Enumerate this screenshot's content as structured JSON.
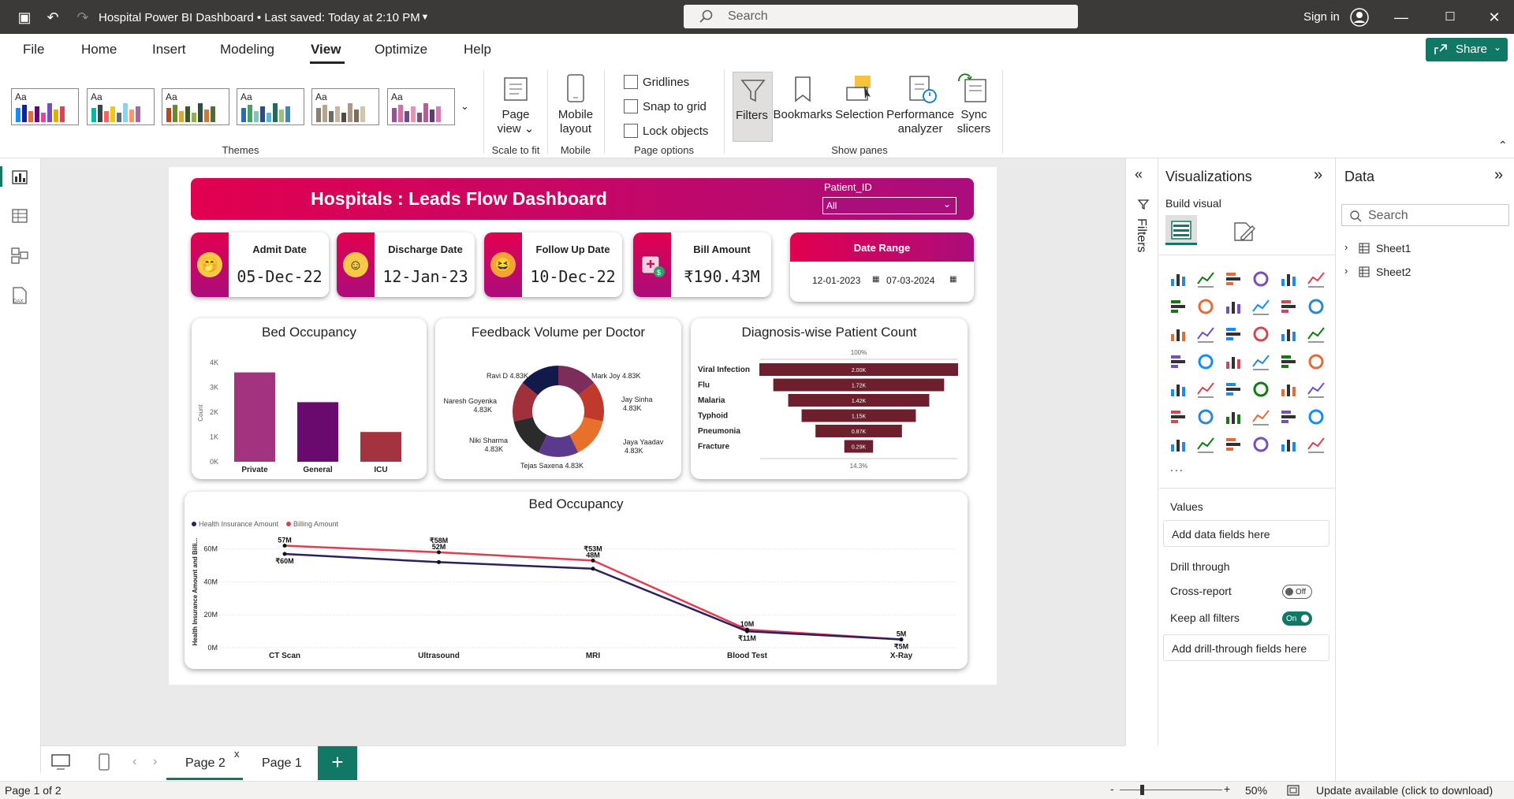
{
  "title_bar": {
    "doc_title": "Hospital Power BI Dashboard • Last saved: Today at 2:10 PM",
    "search_placeholder": "Search",
    "sign_in": "Sign in"
  },
  "menu": {
    "items": [
      "File",
      "Home",
      "Insert",
      "Modeling",
      "View",
      "Optimize",
      "Help"
    ],
    "active": "View",
    "share": "Share"
  },
  "ribbon": {
    "themes_label": "Themes",
    "theme_aa": "Aa",
    "page_view": "Page view",
    "scale_to_fit": "Scale to fit",
    "mobile_layout": "Mobile layout",
    "mobile": "Mobile",
    "gridlines": "Gridlines",
    "snap_to_grid": "Snap to grid",
    "lock_objects": "Lock objects",
    "page_options": "Page options",
    "filters": "Filters",
    "bookmarks": "Bookmarks",
    "selection": "Selection",
    "performance_analyzer": "Performance analyzer",
    "sync_slicers": "Sync slicers",
    "show_panes": "Show panes"
  },
  "dashboard": {
    "header_title": "Hospitals : Leads Flow Dashboard",
    "patient_id_label": "Patient_ID",
    "patient_id_value": "All",
    "kpis": [
      {
        "label": "Admit Date",
        "value": "05-Dec-22"
      },
      {
        "label": "Discharge Date",
        "value": "12-Jan-23"
      },
      {
        "label": "Follow Up Date",
        "value": "10-Dec-22"
      },
      {
        "label": "Bill Amount",
        "value": "₹190.43M"
      }
    ],
    "date_range": {
      "label": "Date Range",
      "start": "12-01-2023",
      "end": "07-03-2024"
    }
  },
  "chart_data": [
    {
      "type": "bar",
      "title": "Bed Occupancy",
      "ylabel": "Count",
      "categories": [
        "Private",
        "General",
        "ICU"
      ],
      "values": [
        3600,
        2400,
        1200
      ],
      "yticks": [
        "4K",
        "3K",
        "2K",
        "1K",
        "0K"
      ],
      "ylim": [
        0,
        4000
      ],
      "colors": [
        "#a3337f",
        "#6a0a6e",
        "#a3343f"
      ]
    },
    {
      "type": "pie",
      "title": "Feedback Volume per Doctor",
      "labels": [
        "Mark Joy 4.83K",
        "Jay Sinha 4.83K",
        "Jaya Yaadav 4.83K",
        "Tejas Saxena 4.83K",
        "Niki Sharma 4.83K",
        "Naresh Goyenka 4.83K",
        "Ravi D 4.83K"
      ],
      "values": [
        4830,
        4830,
        4830,
        4830,
        4830,
        4830,
        4830
      ],
      "colors": [
        "#7c2d5c",
        "#c0392b",
        "#e8702a",
        "#5b3a8e",
        "#2b2b2b",
        "#a0303c",
        "#121a4a"
      ]
    },
    {
      "type": "bar",
      "subtype": "funnel",
      "title": "Diagnosis-wise Patient Count",
      "categories": [
        "Viral Infection",
        "Flu",
        "Malaria",
        "Typhoid",
        "Pneumonia",
        "Fracture"
      ],
      "values": [
        2000,
        1720,
        1420,
        1150,
        870,
        290
      ],
      "value_labels": [
        "2.00K",
        "1.72K",
        "1.42K",
        "1.15K",
        "0.87K",
        "0.29K"
      ],
      "top_label": "100%",
      "bottom_label": "14.3%",
      "color": "#6e1f2e"
    },
    {
      "type": "line",
      "title": "Bed Occupancy",
      "ylabel": "Health Insurance Amount and Billi...",
      "categories": [
        "CT Scan",
        "Ultrasound",
        "MRI",
        "Blood Test",
        "X-Ray"
      ],
      "yticks": [
        "60M",
        "40M",
        "20M",
        "0M"
      ],
      "ylim": [
        0,
        68
      ],
      "series": [
        {
          "name": "Health Insurance Amount",
          "values": [
            57,
            52,
            48,
            10,
            5
          ],
          "labels": [
            "57M",
            "52M",
            "48M",
            "10M",
            "5M"
          ],
          "color": "#2e1f5e"
        },
        {
          "name": "Billing Amount",
          "values": [
            62,
            58,
            53,
            11,
            5
          ],
          "labels": [
            "₹60M",
            "₹58M",
            "₹53M",
            "₹11M",
            "₹5M"
          ],
          "color": "#e23c4e"
        }
      ]
    }
  ],
  "filters_strip": {
    "label": "Filters"
  },
  "visualizations": {
    "title": "Visualizations",
    "build_visual": "Build visual",
    "values": "Values",
    "add_data_fields": "Add data fields here",
    "drill_through": "Drill through",
    "cross_report": "Cross-report",
    "cross_report_state": "Off",
    "keep_all_filters": "Keep all filters",
    "keep_all_filters_state": "On",
    "add_drill_fields": "Add drill-through fields here",
    "more": "..."
  },
  "data_pane": {
    "title": "Data",
    "search_placeholder": "Search",
    "tables": [
      "Sheet1",
      "Sheet2"
    ]
  },
  "page_tabs": {
    "tabs": [
      "Page 2",
      "Page 1"
    ],
    "active": "Page 2",
    "add": "+"
  },
  "status": {
    "page": "Page 1 of 2",
    "zoom": "50%",
    "update": "Update available (click to download)"
  }
}
